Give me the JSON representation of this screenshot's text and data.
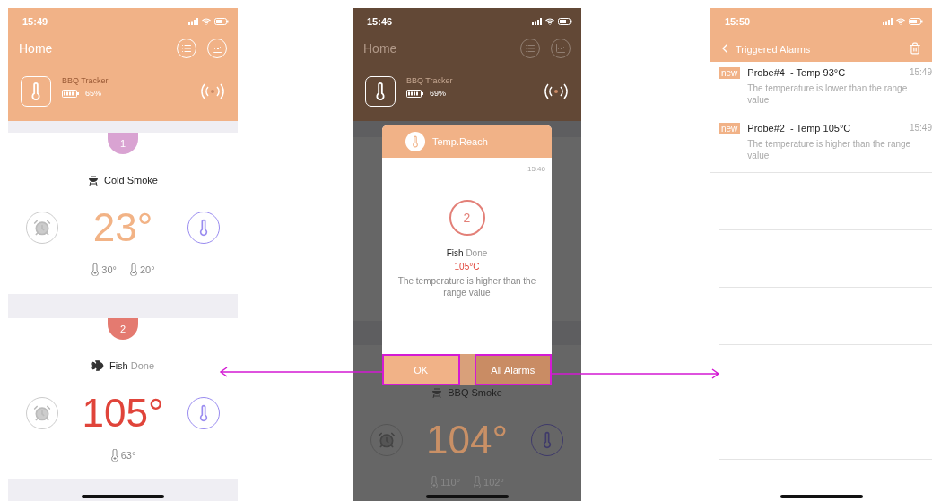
{
  "screens": [
    {
      "kind": "home",
      "time": "15:49",
      "title": "Home",
      "device": {
        "name": "BBQ Tracker",
        "battery": "65%"
      },
      "probes": [
        {
          "badge": "1",
          "color": "#d9a3d2",
          "kind": "grill",
          "name": "Cold Smoke",
          "alert": false,
          "temp": "23°",
          "targets": [
            {
              "kind": "max",
              "value": "30°"
            },
            {
              "kind": "min",
              "value": "20°"
            }
          ]
        },
        {
          "badge": "2",
          "color": "#e47a70",
          "kind": "fish",
          "name": "Fish",
          "status": "Done",
          "alert": true,
          "temp": "105°",
          "targets": [
            {
              "kind": "max",
              "value": "63°"
            }
          ]
        }
      ]
    },
    {
      "kind": "home",
      "time": "15:46",
      "title": "Home",
      "device": {
        "name": "BBQ Tracker",
        "battery": "69%"
      },
      "probes": [
        {
          "kind": "grill",
          "name": "BBQ Smoke",
          "alert": false,
          "temp": "104°",
          "targets": [
            {
              "kind": "max",
              "value": "110°"
            },
            {
              "kind": "min",
              "value": "102°"
            }
          ]
        }
      ],
      "dialog": {
        "title": "Temp.Reach",
        "time": "15:46",
        "badge": "2",
        "name": "Fish",
        "status": "Done",
        "reading": "105°C",
        "message": "The temperature is higher than the range value",
        "buttons": [
          {
            "label": "OK",
            "kind": "primary",
            "highlighted": true
          },
          {
            "label": "All Alarms",
            "kind": "secondary",
            "highlighted": true
          }
        ]
      }
    },
    {
      "kind": "alarms",
      "time": "15:50",
      "title": "Triggered Alarms",
      "alarms": [
        {
          "tag": "new",
          "title": "Probe#4  - Temp 93°C",
          "time": "15:49",
          "message": "The temperature is lower than the range value"
        },
        {
          "tag": "new",
          "title": "Probe#2  - Temp 105°C",
          "time": "15:49",
          "message": "The temperature is higher than the range value"
        }
      ]
    }
  ],
  "arrows": [
    {
      "kind": "left"
    },
    {
      "kind": "right"
    }
  ]
}
